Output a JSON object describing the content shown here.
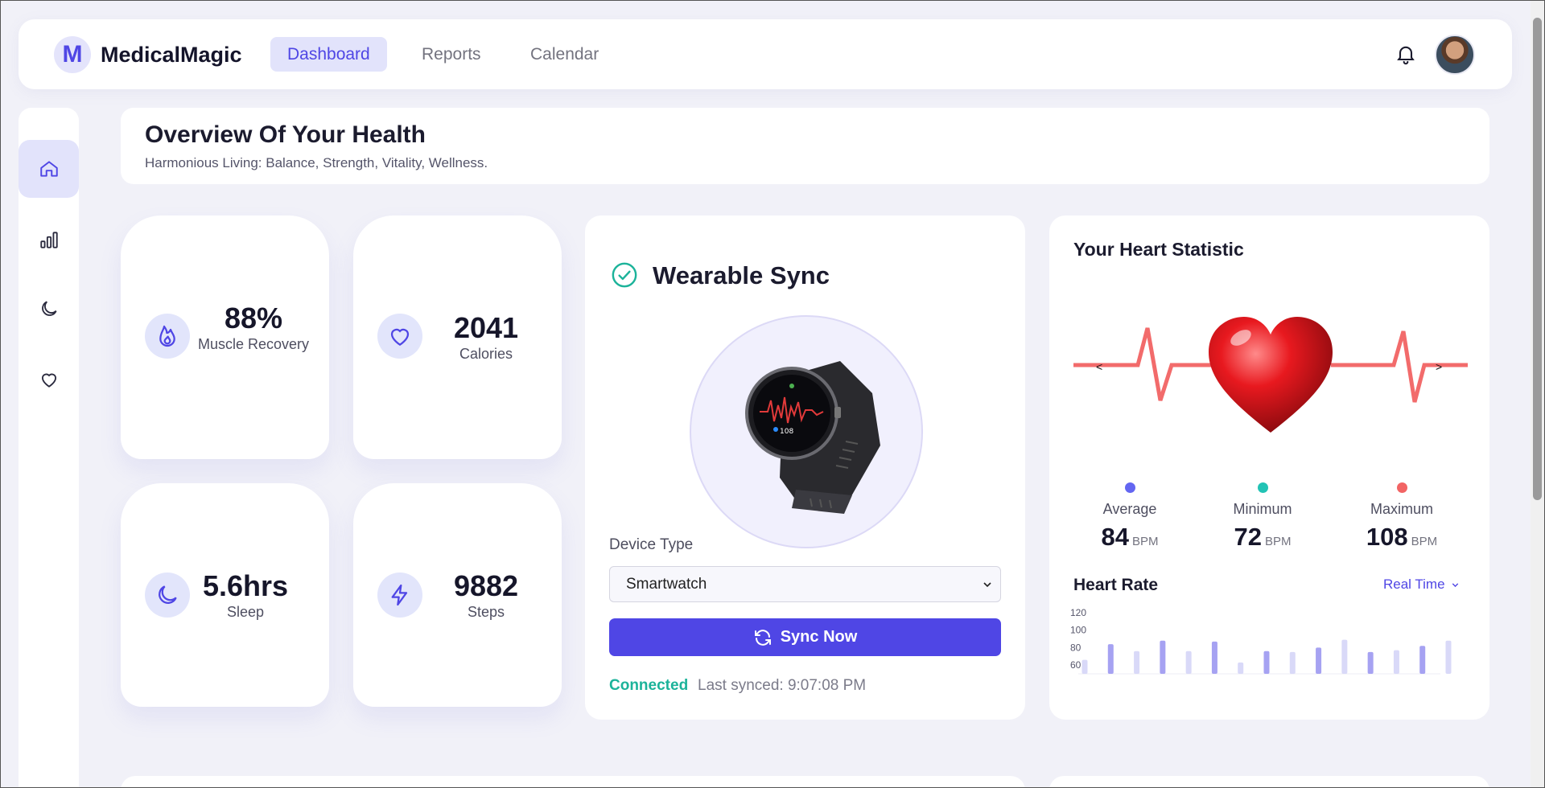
{
  "brand": {
    "logo_letter": "M",
    "name": "MedicalMagic",
    "accent": "#4f46e5"
  },
  "nav": {
    "items": [
      {
        "label": "Dashboard",
        "active": true
      },
      {
        "label": "Reports",
        "active": false
      },
      {
        "label": "Calendar",
        "active": false
      }
    ]
  },
  "header_icons": [
    "bell-icon",
    "avatar"
  ],
  "sidebar": {
    "items": [
      {
        "icon": "home-icon",
        "active": true
      },
      {
        "icon": "bar-chart-icon",
        "active": false
      },
      {
        "icon": "moon-icon",
        "active": false
      },
      {
        "icon": "heart-icon",
        "active": false
      }
    ]
  },
  "overview": {
    "title": "Overview Of Your Health",
    "subtitle": "Harmonious Living: Balance, Strength, Vitality, Wellness."
  },
  "stats": [
    {
      "icon": "flame-icon",
      "value": "88%",
      "label": "Muscle Recovery"
    },
    {
      "icon": "heart-icon",
      "value": "2041",
      "label": "Calories"
    },
    {
      "icon": "moon-icon",
      "value": "5.6hrs",
      "label": "Sleep"
    },
    {
      "icon": "lightning-icon",
      "value": "9882",
      "label": "Steps"
    }
  ],
  "wearable": {
    "title": "Wearable Sync",
    "image": "smartwatch-image",
    "device_type_label": "Device Type",
    "device_type_value": "Smartwatch",
    "sync_button": "Sync Now",
    "status": "Connected",
    "last_synced": "Last synced: 9:07:08 PM",
    "status_color": "#1cb39a"
  },
  "heart": {
    "title": "Your Heart Statistic",
    "prev": "<",
    "next": ">",
    "stats": [
      {
        "label": "Average",
        "value": "84",
        "unit": "BPM",
        "color": "#6366f1"
      },
      {
        "label": "Minimum",
        "value": "72",
        "unit": "BPM",
        "color": "#22c3b5"
      },
      {
        "label": "Maximum",
        "value": "108",
        "unit": "BPM",
        "color": "#f26464"
      }
    ],
    "chart_title": "Heart Rate",
    "chart_mode": "Real Time"
  },
  "chart_data": {
    "type": "bar",
    "yticks": [
      "120",
      "100",
      "80",
      "60"
    ],
    "ylim": [
      50,
      120
    ],
    "values": [
      66,
      84,
      76,
      88,
      76,
      87,
      63,
      76,
      75,
      80,
      89,
      75,
      77,
      82,
      88
    ],
    "colors": [
      "#d9d9f8",
      "#a6a2f2"
    ]
  }
}
